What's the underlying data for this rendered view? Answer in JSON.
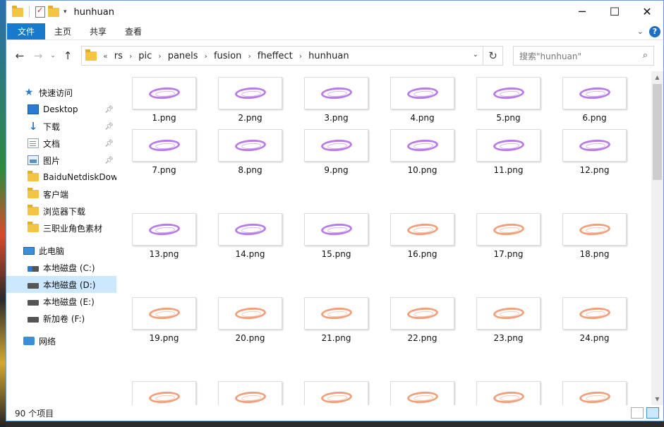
{
  "window": {
    "title": "hunhuan",
    "controls": {
      "minimize": "─",
      "maximize": "☐",
      "close": "✕"
    }
  },
  "ribbon": {
    "tabs": [
      "文件",
      "主页",
      "共享",
      "查看"
    ],
    "help": "?"
  },
  "navbar": {
    "back": "←",
    "forward": "→",
    "recent": "⌄",
    "up": "↑",
    "overflow": "«",
    "breadcrumb": [
      "rs",
      "pic",
      "panels",
      "fusion",
      "fheffect",
      "hunhuan"
    ],
    "refresh": "↻",
    "search_placeholder": "搜索\"hunhuan\""
  },
  "sidebar": {
    "quick_access": "快速访问",
    "pinned": [
      {
        "label": "Desktop",
        "icon": "desktop-icon"
      },
      {
        "label": "下载",
        "icon": "download-icon"
      },
      {
        "label": "文档",
        "icon": "documents-icon"
      },
      {
        "label": "图片",
        "icon": "pictures-icon"
      }
    ],
    "folders": [
      "BaiduNetdiskDow",
      "客户端",
      "浏览器下载",
      "三职业角色素材"
    ],
    "this_pc": "此电脑",
    "drives": [
      {
        "label": "本地磁盘 (C:)",
        "selected": false
      },
      {
        "label": "本地磁盘 (D:)",
        "selected": true
      },
      {
        "label": "本地磁盘 (E:)",
        "selected": false
      },
      {
        "label": "新加卷 (F:)",
        "selected": false
      }
    ],
    "network": "网络"
  },
  "files": {
    "colors": {
      "purple": "#b97be8",
      "orange": "#f2a07b"
    },
    "items": [
      {
        "name": "1.png",
        "color": "purple"
      },
      {
        "name": "2.png",
        "color": "purple"
      },
      {
        "name": "3.png",
        "color": "purple"
      },
      {
        "name": "4.png",
        "color": "purple"
      },
      {
        "name": "5.png",
        "color": "purple"
      },
      {
        "name": "6.png",
        "color": "purple"
      },
      {
        "name": "7.png",
        "color": "purple"
      },
      {
        "name": "8.png",
        "color": "purple"
      },
      {
        "name": "9.png",
        "color": "purple"
      },
      {
        "name": "10.png",
        "color": "purple"
      },
      {
        "name": "11.png",
        "color": "purple"
      },
      {
        "name": "12.png",
        "color": "purple"
      },
      {
        "name": "13.png",
        "color": "purple"
      },
      {
        "name": "14.png",
        "color": "purple"
      },
      {
        "name": "15.png",
        "color": "purple"
      },
      {
        "name": "16.png",
        "color": "orange"
      },
      {
        "name": "17.png",
        "color": "orange"
      },
      {
        "name": "18.png",
        "color": "orange"
      },
      {
        "name": "19.png",
        "color": "orange"
      },
      {
        "name": "20.png",
        "color": "orange"
      },
      {
        "name": "21.png",
        "color": "orange"
      },
      {
        "name": "22.png",
        "color": "orange"
      },
      {
        "name": "23.png",
        "color": "orange"
      },
      {
        "name": "24.png",
        "color": "orange"
      },
      {
        "name": "",
        "color": "orange"
      },
      {
        "name": "",
        "color": "orange"
      },
      {
        "name": "",
        "color": "orange"
      },
      {
        "name": "",
        "color": "orange"
      },
      {
        "name": "",
        "color": "orange"
      },
      {
        "name": "",
        "color": "orange"
      }
    ]
  },
  "status": {
    "count": "90 个项目"
  }
}
